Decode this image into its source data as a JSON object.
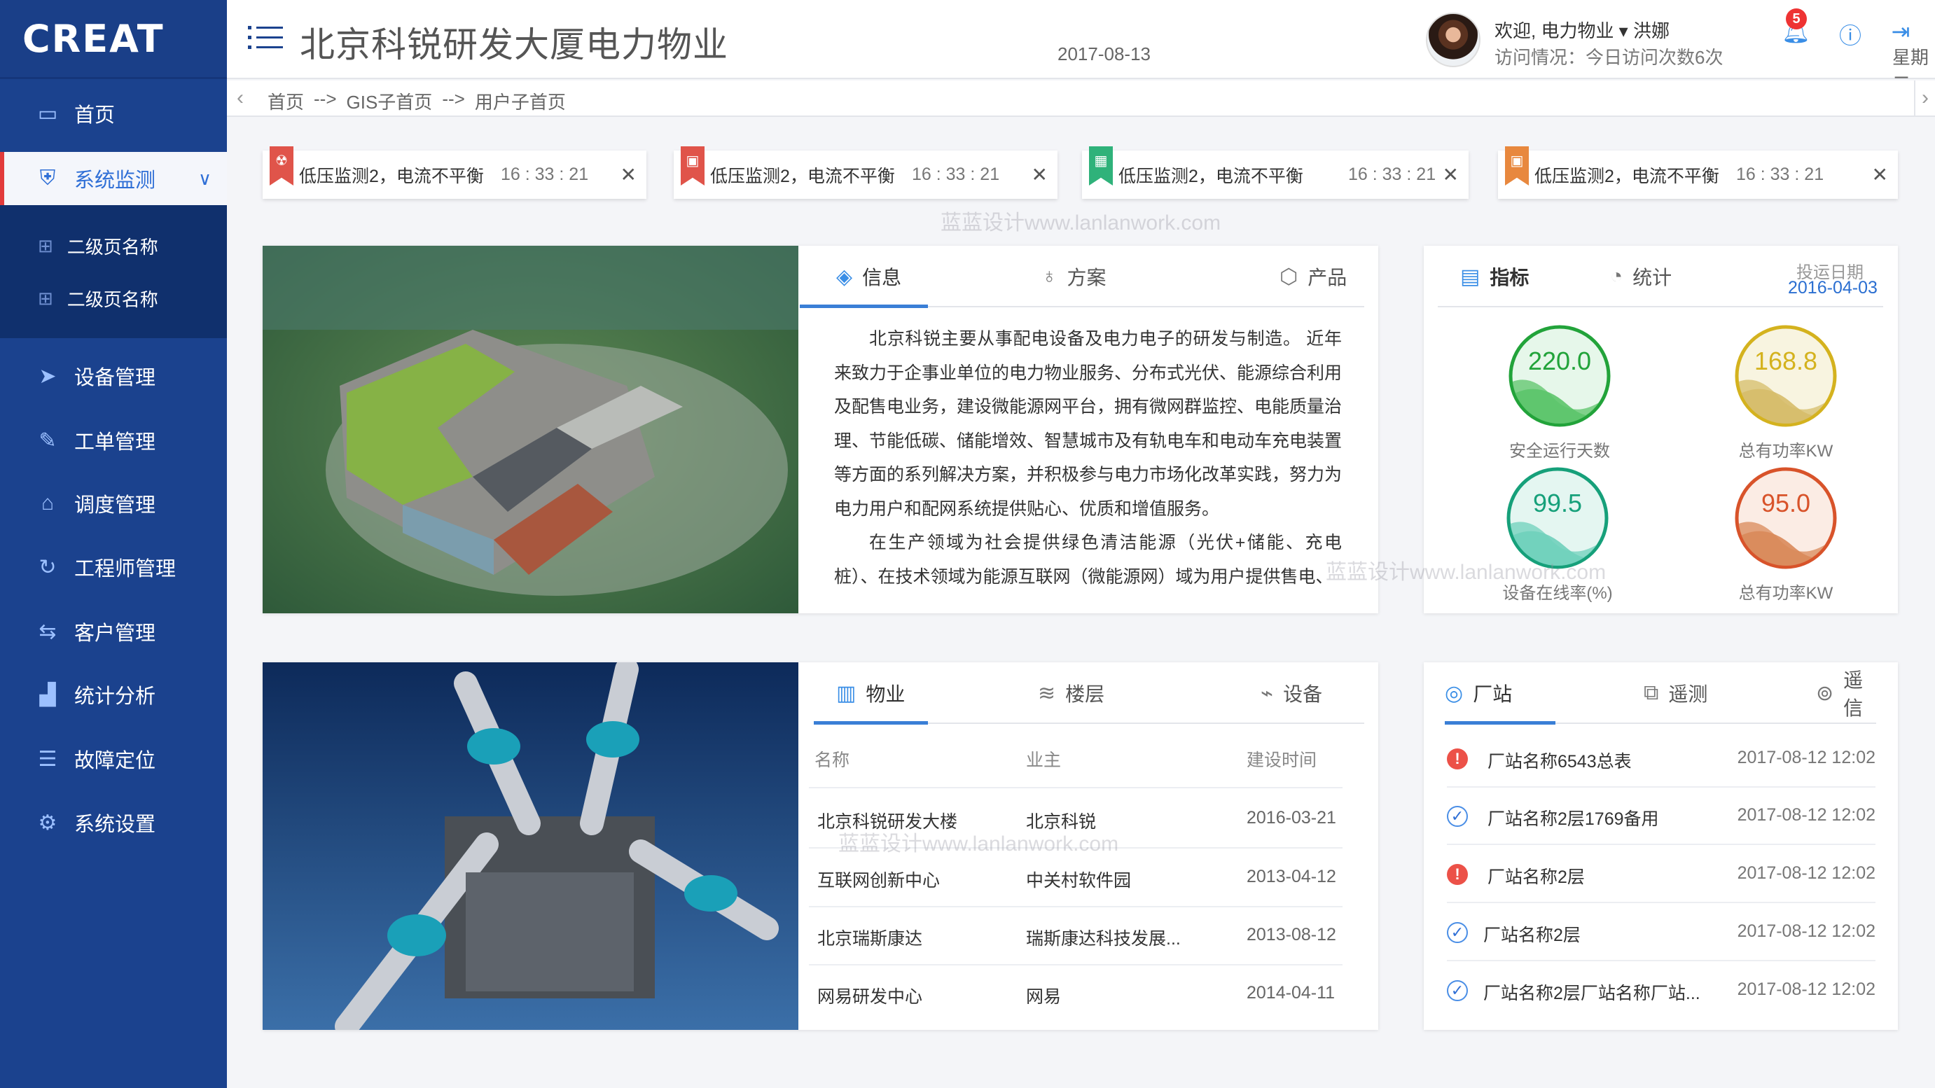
{
  "sidebar": {
    "logo": "CREAT",
    "items": [
      {
        "label": "首页",
        "icon": "monitor-icon"
      },
      {
        "label": "系统监测",
        "icon": "shield-icon",
        "active": true
      },
      {
        "label": "设备管理",
        "icon": "send-icon"
      },
      {
        "label": "工单管理",
        "icon": "pen-icon"
      },
      {
        "label": "调度管理",
        "icon": "home-icon"
      },
      {
        "label": "工程师管理",
        "icon": "refresh-icon"
      },
      {
        "label": "客户管理",
        "icon": "exchange-icon"
      },
      {
        "label": "统计分析",
        "icon": "chart-icon"
      },
      {
        "label": "故障定位",
        "icon": "list-icon"
      },
      {
        "label": "系统设置",
        "icon": "gear-icon"
      }
    ],
    "submenu": [
      {
        "label": "二级页名称"
      },
      {
        "label": "二级页名称"
      }
    ]
  },
  "header": {
    "title": "北京科锐研发大厦电力物业",
    "welcome": "欢迎, 电力物业 ▾ 洪娜",
    "visits": "访问情况：今日访问次数6次",
    "notification_count": "5",
    "date": "2017-08-13",
    "weekday": "星期二"
  },
  "breadcrumb": [
    "首页",
    "-->",
    "GIS子首页",
    "-->",
    "用户子首页"
  ],
  "alerts": [
    {
      "message": "低压监测2，电流不平衡",
      "time": "16 : 33 : 21",
      "color": "#e0544a",
      "icon": "radiation-icon"
    },
    {
      "message": "低压监测2，电流不平衡",
      "time": "16 : 33 : 21",
      "color": "#e0544a",
      "icon": "printer-icon"
    },
    {
      "message": "低压监测2，电流不平衡",
      "time": "16 : 33 : 21",
      "color": "#2fb27a",
      "icon": "calculator-icon"
    },
    {
      "message": "低压监测2，电流不平衡",
      "time": "16 : 33 : 21",
      "color": "#e8883e",
      "icon": "printer-icon"
    }
  ],
  "info_panel": {
    "tabs": [
      "信息",
      "方案",
      "产品"
    ],
    "paragraphs": [
      "北京科锐主要从事配电设备及电力电子的研发与制造。 近年来致力于企事业单位的电力物业服务、分布式光伏、能源综合利用及配售电业务，建设微能源网平台，拥有微网群监控、电能质量治理、节能低碳、储能增效、智慧城市及有轨电车和电动车充电装置等方面的系列解决方案，并积极参与电力市场化改革实践，努力为电力用户和配网系统提供贴心、优质和增值服务。",
      "在生产领域为社会提供绿色清洁能源（光伏+储能、充电桩）、在技术领域为能源互联网（微能源网）域为用户提供售电、"
    ]
  },
  "metrics_panel": {
    "tabs": [
      "指标",
      "统计"
    ],
    "date_label": "投运日期",
    "date_value": "2016-04-03",
    "gauges": [
      {
        "value": "220.0",
        "label": "安全运行天数",
        "color": "#22a33a",
        "fill": "#5cc46a",
        "bg": "#e6f7ea"
      },
      {
        "value": "168.8",
        "label": "总有功率KW",
        "color": "#d4b21e",
        "fill": "#d6bd6a",
        "bg": "#f8f4e0"
      },
      {
        "value": "99.5",
        "label": "设备在线率(%)",
        "color": "#16a07a",
        "fill": "#6fd0bb",
        "bg": "#e4f6f1"
      },
      {
        "value": "95.0",
        "label": "总有功率KW",
        "color": "#d8532a",
        "fill": "#d9895a",
        "bg": "#fbece4"
      }
    ]
  },
  "property_panel": {
    "tabs": [
      "物业",
      "楼层",
      "设备"
    ],
    "columns": [
      "名称",
      "业主",
      "建设时间"
    ],
    "rows": [
      [
        "北京科锐研发大楼",
        "北京科锐",
        "2016-03-21"
      ],
      [
        "互联网创新中心",
        "中关村软件园",
        "2013-04-12"
      ],
      [
        "北京瑞斯康达",
        "瑞斯康达科技发展...",
        "2013-08-12"
      ],
      [
        "网易研发中心",
        "网易",
        "2014-04-11"
      ]
    ]
  },
  "station_panel": {
    "tabs": [
      "厂站",
      "遥测",
      "遥信"
    ],
    "items": [
      {
        "name": "厂站名称6543总表",
        "date": "2017-08-12 12:02",
        "status": "error"
      },
      {
        "name": "厂站名称2层1769备用",
        "date": "2017-08-12 12:02",
        "status": "ok"
      },
      {
        "name": "厂站名称2层",
        "date": "2017-08-12 12:02",
        "status": "error"
      },
      {
        "name": "厂站名称2层",
        "date": "2017-08-12 12:02",
        "status": "ok"
      },
      {
        "name": "厂站名称2层厂站名称厂站...",
        "date": "2017-08-12 12:02",
        "status": "ok"
      }
    ]
  },
  "watermark": [
    "蓝蓝设计www.lanlanwork.com",
    "蓝蓝设计www.lanlanwork.com",
    "蓝蓝设计www.lanlanwork.com"
  ]
}
